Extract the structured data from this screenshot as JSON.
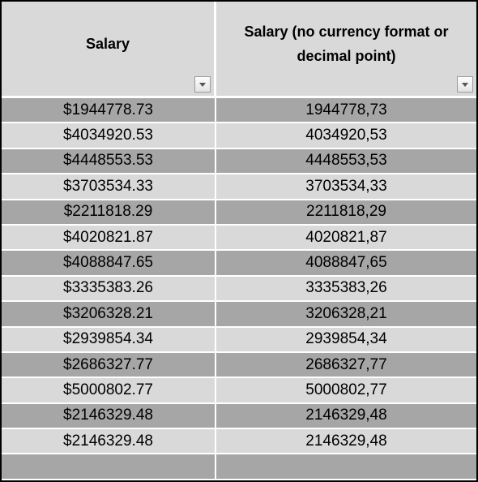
{
  "table": {
    "headers": [
      {
        "label": "Salary",
        "filter_icon": "dropdown-arrow-icon"
      },
      {
        "label": "Salary (no currency format or decimal point)",
        "filter_icon": "dropdown-arrow-icon"
      }
    ],
    "rows": [
      [
        "$1944778.73",
        "1944778,73"
      ],
      [
        "$4034920.53",
        "4034920,53"
      ],
      [
        "$4448553.53",
        "4448553,53"
      ],
      [
        "$3703534.33",
        "3703534,33"
      ],
      [
        "$2211818.29",
        "2211818,29"
      ],
      [
        "$4020821.87",
        "4020821,87"
      ],
      [
        "$4088847.65",
        "4088847,65"
      ],
      [
        "$3335383.26",
        "3335383,26"
      ],
      [
        "$3206328.21",
        "3206328,21"
      ],
      [
        "$2939854.34",
        "2939854,34"
      ],
      [
        "$2686327.77",
        "2686327,77"
      ],
      [
        "$5000802.77",
        "5000802,77"
      ],
      [
        "$2146329.48",
        "2146329,48"
      ],
      [
        "$2146329.48",
        "2146329,48"
      ],
      [
        "",
        ""
      ]
    ],
    "colors": {
      "band_dark": "#a6a6a6",
      "band_light": "#d9d9d9",
      "header_bg": "#d9d9d9",
      "border": "#000000"
    }
  }
}
